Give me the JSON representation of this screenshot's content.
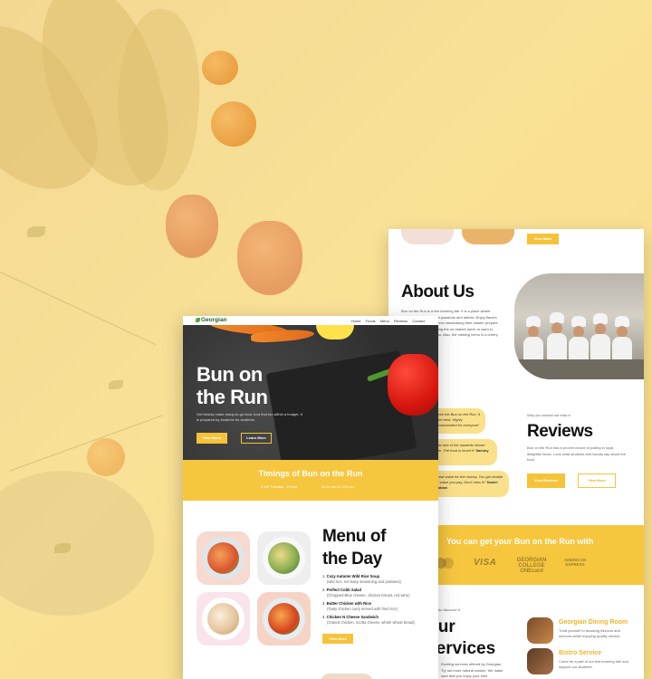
{
  "colors": {
    "accent": "#f7c63f",
    "background": "#f8df8c",
    "hero_dark": "#3c3c3c",
    "text_dark": "#111111",
    "service_title": "#eab52a"
  },
  "front_page": {
    "nav": {
      "logo": "Georgian",
      "items": [
        "Home",
        "Foods",
        "Menu",
        "Reviews",
        "Contact"
      ]
    },
    "hero": {
      "title_line1": "Bun on",
      "title_line2": "the Run",
      "text": "Get freshly made ready-to-go food. And that too within a budget. It is prepared by students for students.",
      "primary_button": "View Menu",
      "secondary_button": "Learn More"
    },
    "timings": {
      "title": "Timings of Bun on the Run",
      "days": "8 AM Tuesday - Friday",
      "hours": "11:30 am to 1:00 pm"
    },
    "menu": {
      "title_line1": "Menu of",
      "title_line2": "the Day",
      "items": [
        {
          "number": "1.",
          "name": "Cozy Autumn Wild Rice Soup",
          "desc": "(wild rice, not baby seasoning and potatoes)"
        },
        {
          "number": "2.",
          "name": "Perfect Cobb Salad",
          "desc": "(Chopped Blue cheese, chicken breast, red wine)"
        },
        {
          "number": "3.",
          "name": "Butter Chicken with Rice",
          "desc": "(Tasty chicken curry served with fried rice)"
        },
        {
          "number": "4.",
          "name": "Chicken N Cheese Sandwich",
          "desc": "(Grated chicken, ricotta cheese, whole wheat bread)"
        }
      ],
      "button": "View More"
    }
  },
  "back_page": {
    "top_button": "View More",
    "about": {
      "title": "About Us",
      "text": "Bun on the Run is a live learning lab. It is a place where students showcase their passions and talents. Enjoy flavors like never before. Students showcasing their master prepare delicious meals. Grabbing the on-market lunch or want to enjoy, then this is for you. Also, the rotating menu is a cherry on top."
    },
    "testimonials": [
      {
        "text": "\"I love the Bun on the Run. It is the best. Highly recommended for everyone\"",
        "author": ""
      },
      {
        "text": "\"Just one of the students shown here. The food is loved it\"",
        "author": "Sammy"
      },
      {
        "text": "\"Great value for the money. You get double the value you pay. Don't miss it!\"",
        "author": "Daniel Graham"
      }
    ],
    "reviews": {
      "kicker": "Why you should not miss it",
      "title": "Reviews",
      "text": "Bun on the Run has a proven record of pulling in loyal, delightful faces. Look what students and faculty say about the food.",
      "primary_button": "View Reviews",
      "secondary_button": "View More"
    },
    "payment": {
      "title": "You can get your Bun on the Run with",
      "logos": [
        "VISA",
        "GEORGIAN COLLEGE ONEcard",
        "AMERICAN EXPRESS"
      ]
    },
    "services": {
      "kicker": "Also discover It",
      "title_line1": "Our",
      "title_line2": "Services",
      "text": "Exciting services offered by Georgian. Try out more natural cuisine. We make sure that you enjoy your time.",
      "cards": [
        {
          "title": "Georgian Dining Room",
          "text": "Treat yourself to amazing flavours and services while enjoying quality service."
        },
        {
          "title": "Bistro Service",
          "text": "Come be a part of our live-learning lab! and support our students."
        }
      ]
    }
  }
}
